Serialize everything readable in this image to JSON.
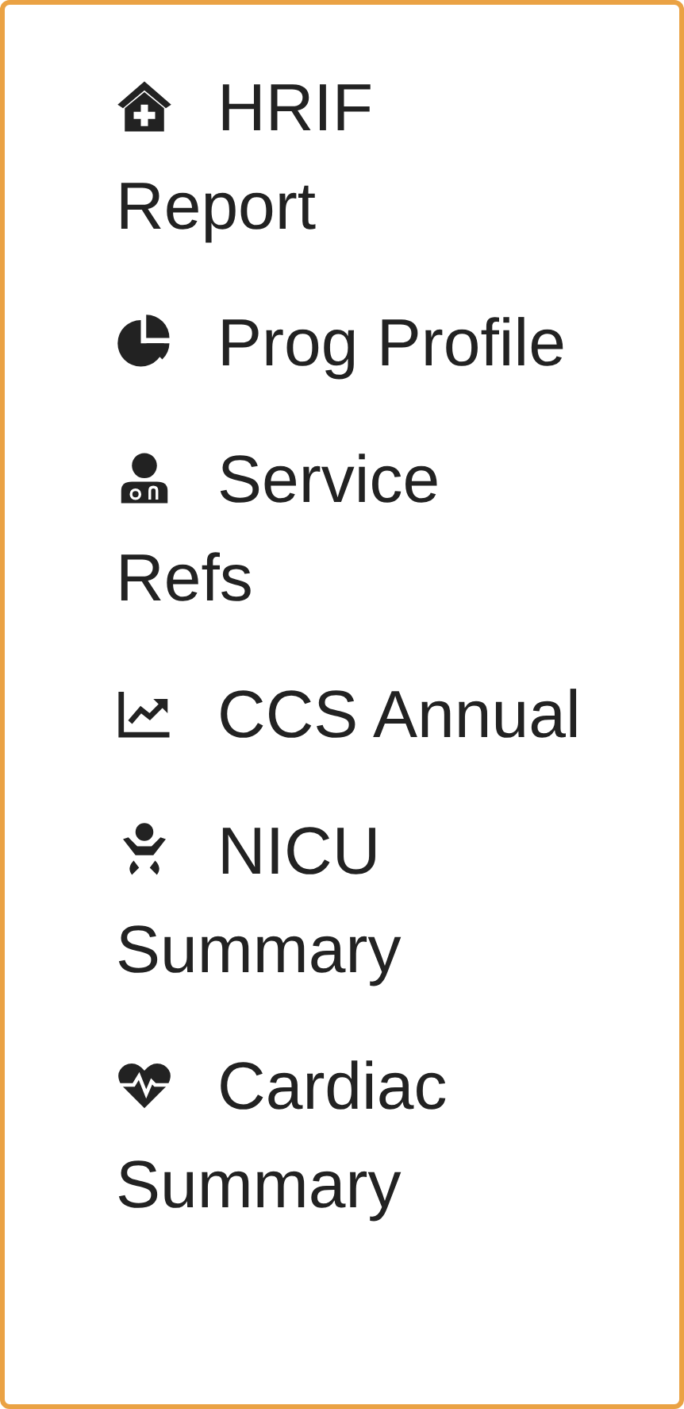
{
  "nav_items": [
    {
      "label": "HRIF Report"
    },
    {
      "label": "Prog Profile"
    },
    {
      "label": "Service Refs"
    },
    {
      "label": "CCS Annual"
    },
    {
      "label": "NICU Summary"
    },
    {
      "label": "Cardiac Summary"
    }
  ]
}
